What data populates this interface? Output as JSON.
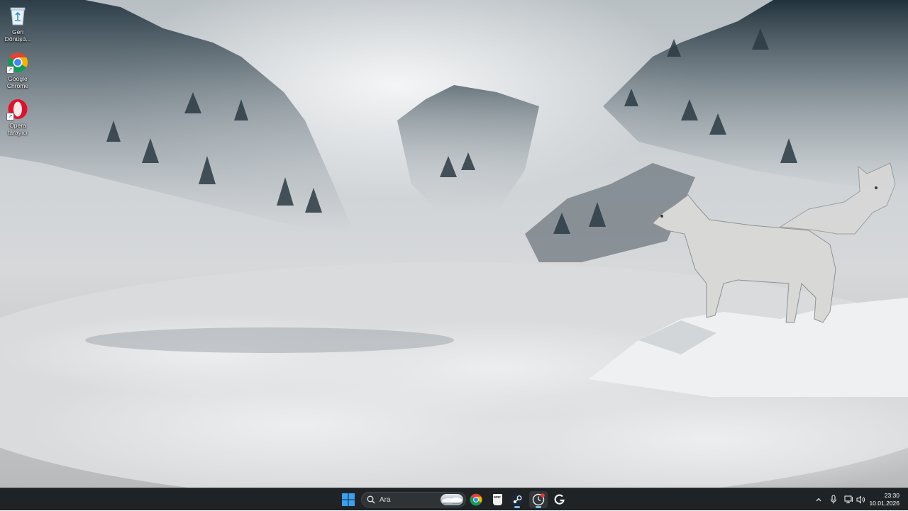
{
  "desktop": {
    "icons": [
      {
        "label": "Geri Dönüşü...",
        "icon": "recycle-bin-icon"
      },
      {
        "label": "Google Chrome",
        "icon": "chrome-icon"
      },
      {
        "label": "Opera tarayıcı",
        "icon": "opera-icon"
      }
    ]
  },
  "taskbar": {
    "search_placeholder": "Ara",
    "pinned": [
      {
        "name": "start",
        "icon": "windows-logo-icon"
      },
      {
        "name": "chrome",
        "icon": "chrome-icon"
      },
      {
        "name": "epic-games",
        "icon": "epic-games-icon",
        "text": "EPIC"
      },
      {
        "name": "steam",
        "icon": "steam-icon"
      },
      {
        "name": "clock-app",
        "icon": "clock-app-icon"
      },
      {
        "name": "g-hub",
        "icon": "logitech-g-icon"
      }
    ],
    "tray": {
      "time": "23:30",
      "date": "10.01.2026"
    }
  },
  "colors": {
    "taskbar_bg": "#1f2326",
    "accent": "#7fb9e6",
    "windows_blue": "#3aa0f0"
  }
}
